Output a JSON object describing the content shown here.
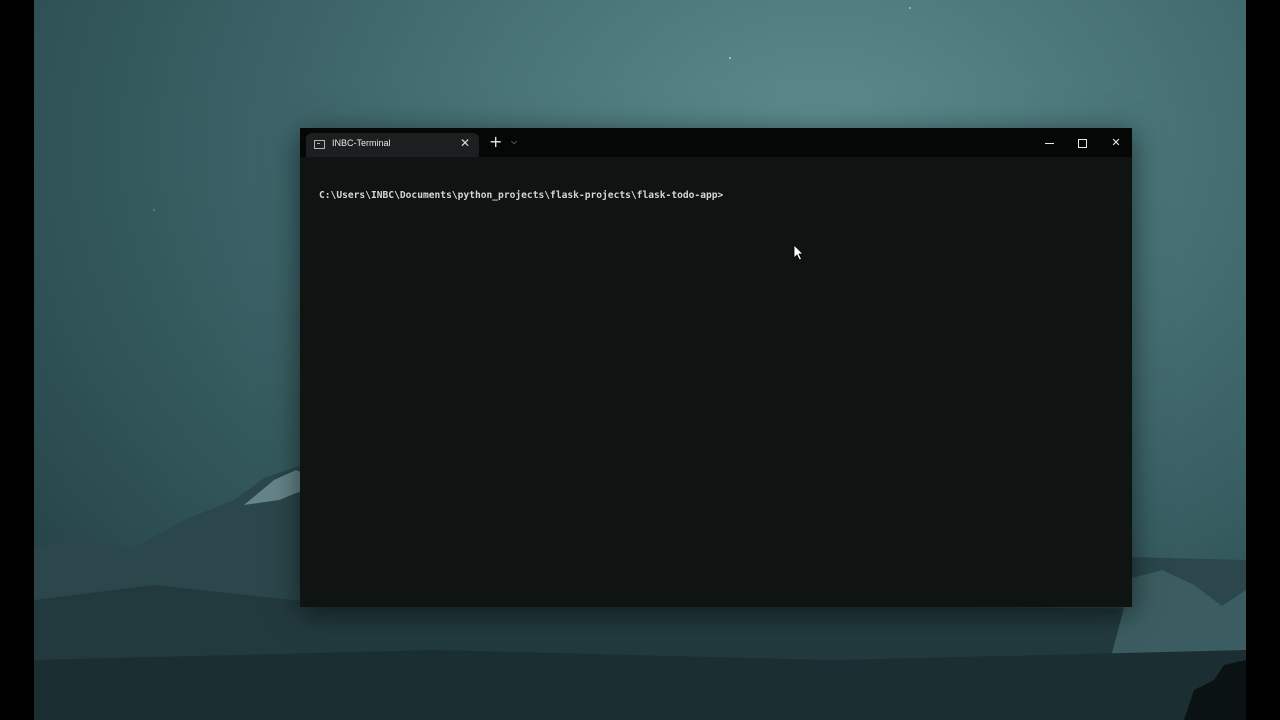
{
  "window": {
    "tab_title": "INBC-Terminal",
    "tab_icon": "terminal-icon",
    "new_tab_symbol": "+",
    "dropdown_symbol": "⌵",
    "close_tab_symbol": "✕",
    "close_window_symbol": "✕"
  },
  "console": {
    "prompt": "C:\\Users\\INBC\\Documents\\python_projects\\flask-projects\\flask-todo-app>"
  },
  "colors": {
    "terminal_background": "#0f1312",
    "titlebar_background": "#050606",
    "text": "#d4d7d6",
    "wallpaper": "#456f73"
  }
}
